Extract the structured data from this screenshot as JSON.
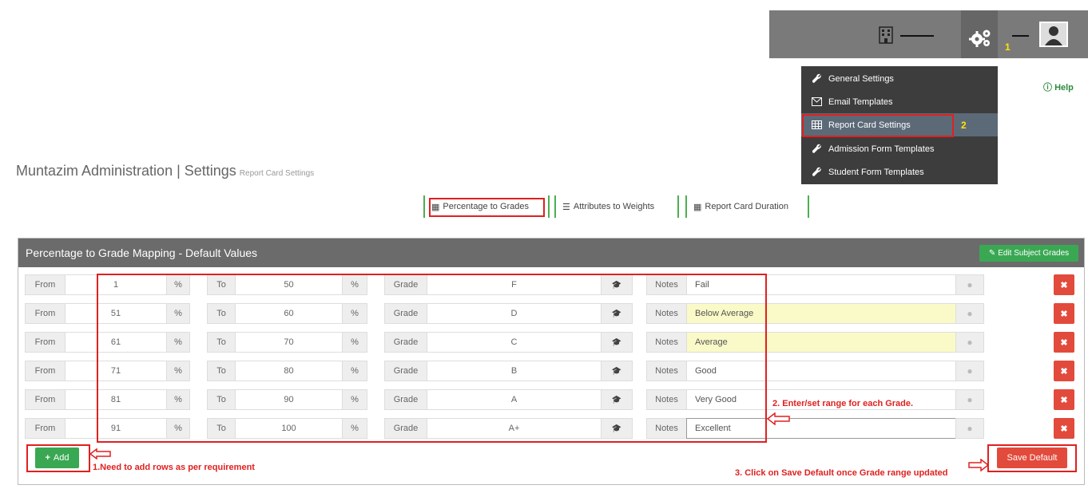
{
  "header": {
    "school_name": "~~~~~~~~",
    "user_name": "~~~~",
    "step1": "1"
  },
  "settings_menu": {
    "items": [
      {
        "label": "General Settings",
        "icon": "wrench-icon"
      },
      {
        "label": "Email Templates",
        "icon": "envelope-icon"
      },
      {
        "label": "Report Card Settings",
        "icon": "table-icon"
      },
      {
        "label": "Admission Form Templates",
        "icon": "wrench-icon"
      },
      {
        "label": "Student Form Templates",
        "icon": "wrench-icon"
      }
    ],
    "active_index": 2,
    "step2": "2"
  },
  "help": {
    "label": "Help"
  },
  "page": {
    "title": "Muntazim Administration | Settings",
    "subtitle": "Report Card Settings"
  },
  "tabs": [
    {
      "label": "Percentage to Grades",
      "icon": "table-icon"
    },
    {
      "label": "Attributes to Weights",
      "icon": "list-icon"
    },
    {
      "label": "Report Card Duration",
      "icon": "calendar-icon"
    }
  ],
  "panel": {
    "title": "Percentage to Grade Mapping - Default Values",
    "edit_button": "Edit Subject Grades",
    "labels": {
      "from": "From",
      "percent": "%",
      "to": "To",
      "grade": "Grade",
      "notes": "Notes"
    },
    "rows": [
      {
        "from": "1",
        "to": "50",
        "grade": "F",
        "notes": "Fail"
      },
      {
        "from": "51",
        "to": "60",
        "grade": "D",
        "notes": "Below Average"
      },
      {
        "from": "61",
        "to": "70",
        "grade": "C",
        "notes": "Average"
      },
      {
        "from": "71",
        "to": "80",
        "grade": "B",
        "notes": "Good"
      },
      {
        "from": "81",
        "to": "90",
        "grade": "A",
        "notes": "Very Good"
      },
      {
        "from": "91",
        "to": "100",
        "grade": "A+",
        "notes": "Excellent"
      }
    ],
    "add_button": "Add",
    "save_button": "Save Default"
  },
  "annotations": {
    "range": "2. Enter/set range for each Grade.",
    "add": "1.Need to add rows as per requirement",
    "save": "3. Click on Save Default once Grade range updated"
  },
  "colors": {
    "accent_green": "#3aa853",
    "danger_red": "#e24a3c",
    "annotation_red": "#e02020",
    "highlight_yellow": "#fafac8"
  }
}
